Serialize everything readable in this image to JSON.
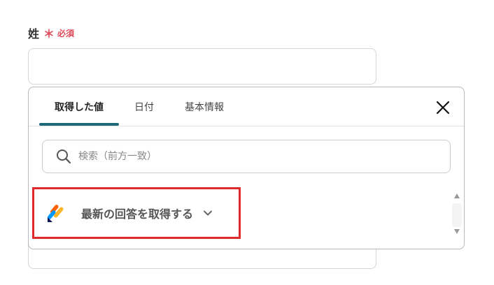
{
  "field": {
    "label": "姓",
    "required_mark": "＊",
    "required_text": "必須",
    "required_color": "#e04b5a"
  },
  "popup": {
    "tabs": [
      {
        "label": "取得した値",
        "active": true
      },
      {
        "label": "日付",
        "active": false
      },
      {
        "label": "基本情報",
        "active": false
      }
    ],
    "accent_color": "#1f6a77",
    "close_icon": "close-icon",
    "search": {
      "placeholder": "検索（前方一致）",
      "value": "",
      "icon": "search-icon"
    },
    "items": [
      {
        "label": "最新の回答を取得する",
        "icon": "jotform-logo-icon",
        "expand_icon": "chevron-down-icon",
        "highlight_color": "#de2a2a"
      }
    ]
  }
}
